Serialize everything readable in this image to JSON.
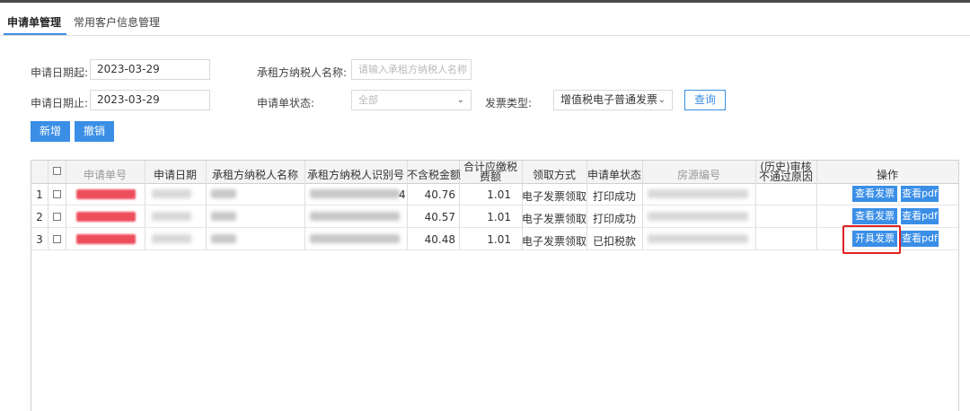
{
  "tabs": [
    {
      "label": "申请单管理",
      "active": true
    },
    {
      "label": "常用客户信息管理",
      "active": false
    }
  ],
  "filters": {
    "date_start_label": "申请日期起:",
    "date_start_value": "2023-03-29",
    "date_end_label": "申请日期止:",
    "date_end_value": "2023-03-29",
    "taxpayer_name_label": "承租方纳税人名称:",
    "taxpayer_name_placeholder": "请输入承租方纳税人名称",
    "status_label": "申请单状态:",
    "status_placeholder": "全部",
    "invoice_type_label": "发票类型:",
    "invoice_type_value": "增值税电子普通发票",
    "query_button": "查询"
  },
  "actions": {
    "add_button": "新增",
    "revoke_button": "撤销"
  },
  "table": {
    "columns": [
      "申请单号",
      "申请日期",
      "承租方纳税人名称",
      "承租方纳税人识别号",
      "不含税金额",
      "合计应缴税费额",
      "领取方式",
      "申请单状态",
      "房源编号",
      "(历史)审核不通过原因",
      "操作"
    ],
    "rows": [
      {
        "index": "1",
        "amount": "40.76",
        "tax": "1.01",
        "method": "电子发票领取",
        "status": "打印成功",
        "id_suffix": "4",
        "action_primary": "查看发票",
        "action_secondary": "查看pdf"
      },
      {
        "index": "2",
        "amount": "40.57",
        "tax": "1.01",
        "method": "电子发票领取",
        "status": "打印成功",
        "id_suffix": "",
        "action_primary": "查看发票",
        "action_secondary": "查看pdf"
      },
      {
        "index": "3",
        "amount": "40.48",
        "tax": "1.01",
        "method": "电子发票领取",
        "status": "已扣税款",
        "id_suffix": "",
        "action_primary": "开具发票",
        "action_secondary": "查看pdf"
      }
    ]
  },
  "colors": {
    "accent": "#3a8ee6",
    "highlight": "#e02020",
    "redacted": "#ee4d5b"
  }
}
